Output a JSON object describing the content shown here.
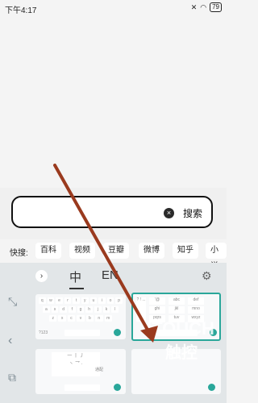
{
  "status": {
    "time": "下午4:17",
    "battery": "79"
  },
  "search": {
    "clear_icon": "×",
    "button": "搜索"
  },
  "quick": {
    "label": "快搜:",
    "chips": [
      "百科",
      "视频",
      "豆瓣",
      "微博",
      "知乎",
      "小说"
    ]
  },
  "keyboard": {
    "tabs": [
      "中",
      "EN"
    ],
    "back_icon": "chevron-right-icon",
    "settings_icon": "gear-icon",
    "layouts": {
      "qwerty_rows": [
        [
          "q",
          "w",
          "e",
          "r",
          "t",
          "y",
          "u",
          "i",
          "o",
          "p"
        ],
        [
          "a",
          "s",
          "d",
          "f",
          "g",
          "h",
          "j",
          "k",
          "l"
        ],
        [
          "z",
          "x",
          "c",
          "v",
          "b",
          "n",
          "m"
        ]
      ],
      "t9_keys": [
        [
          "?",
          "'@",
          "abc",
          "def"
        ],
        [
          "!",
          "ghi",
          "jkl",
          "mno"
        ],
        [
          "...",
          "pqrs",
          "tuv",
          "wxyz"
        ]
      ],
      "num_label": "?123",
      "stroke_label": "通配"
    }
  },
  "watermark": [
    "ITOUCH",
    "触控"
  ]
}
